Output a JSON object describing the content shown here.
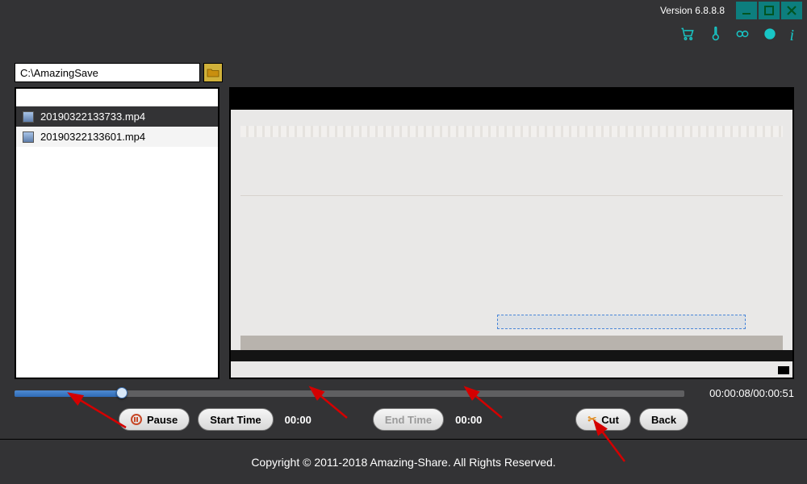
{
  "titlebar": {
    "version": "Version 6.8.8.8"
  },
  "path": {
    "value": "C:\\AmazingSave"
  },
  "files": {
    "items": [
      {
        "name": "20190322133733.mp4",
        "selected": false
      },
      {
        "name": "20190322133601.mp4",
        "selected": true
      }
    ]
  },
  "playback": {
    "current": "00:00:08",
    "total": "00:00:51",
    "progress_pct": 16
  },
  "controls": {
    "pause": "Pause",
    "start_time": "Start Time",
    "start_val": "00:00",
    "end_time": "End Time",
    "end_val": "00:00",
    "cut": "Cut",
    "back": "Back"
  },
  "footer": {
    "copyright": "Copyright © 2011-2018 Amazing-Share. All Rights Reserved."
  }
}
